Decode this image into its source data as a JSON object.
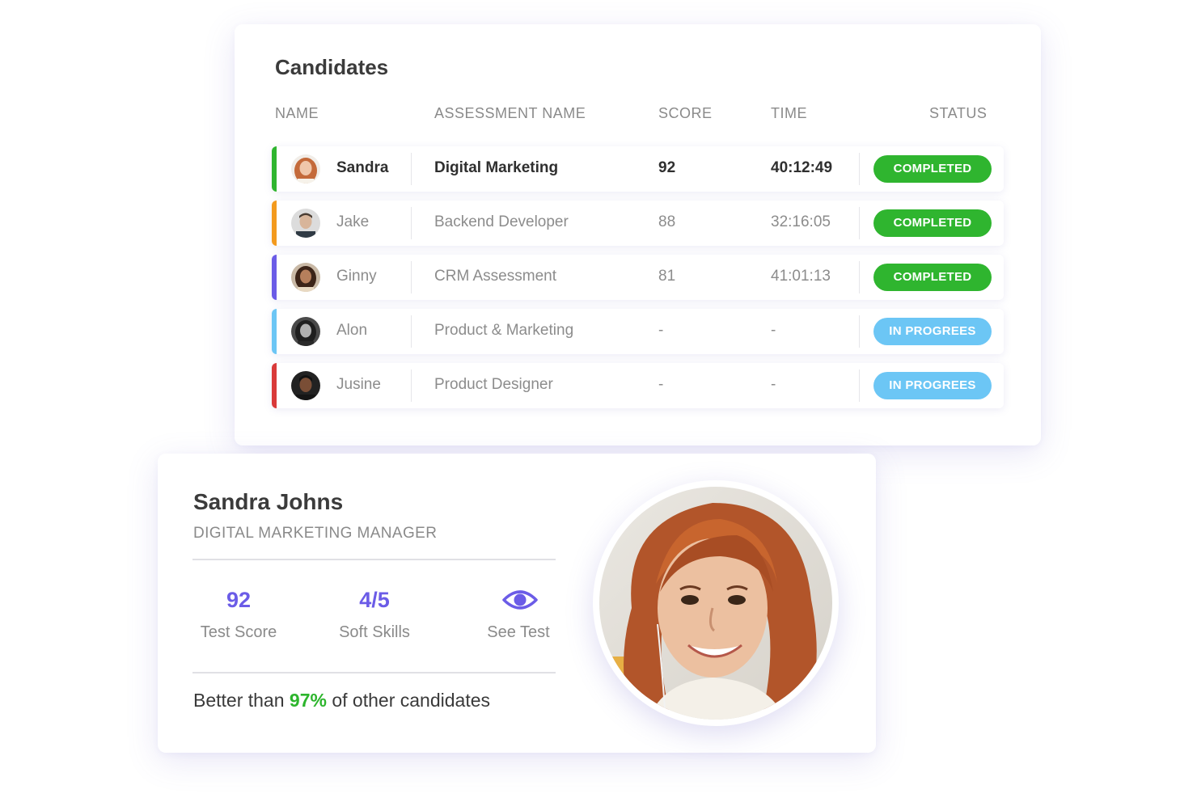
{
  "candidates": {
    "title": "Candidates",
    "columns": [
      "NAME",
      "ASSESSMENT NAME",
      "SCORE",
      "TIME",
      "STATUS"
    ],
    "rows": [
      {
        "name": "Sandra",
        "assessment": "Digital Marketing",
        "score": "92",
        "time": "40:12:49",
        "status": "COMPLETED"
      },
      {
        "name": "Jake",
        "assessment": "Backend Developer",
        "score": "88",
        "time": "32:16:05",
        "status": "COMPLETED"
      },
      {
        "name": "Ginny",
        "assessment": "CRM Assessment",
        "score": "81",
        "time": "41:01:13",
        "status": "COMPLETED"
      },
      {
        "name": "Alon",
        "assessment": "Product & Marketing",
        "score": "-",
        "time": "-",
        "status": "IN PROGREES"
      },
      {
        "name": "Jusine",
        "assessment": "Product Designer",
        "score": "-",
        "time": "-",
        "status": "IN PROGREES"
      }
    ],
    "row_accent_colors": [
      "#2fb52f",
      "#f39a1e",
      "#6b5ce7",
      "#6cc6f5",
      "#d93a3a"
    ]
  },
  "profile": {
    "name": "Sandra Johns",
    "role": "DIGITAL MARKETING MANAGER",
    "stats": [
      {
        "value": "92",
        "label": "Test Score"
      },
      {
        "value": "4/5",
        "label": "Soft Skills"
      },
      {
        "icon": "eye-icon",
        "label": "See Test"
      }
    ],
    "better_prefix": "Better than",
    "better_pct": "97%",
    "better_suffix": "of other candidates"
  },
  "colors": {
    "completed": "#2fb52f",
    "in_progress": "#6cc6f5",
    "accent": "#6b5ce7",
    "highlight_green": "#2db52d"
  }
}
